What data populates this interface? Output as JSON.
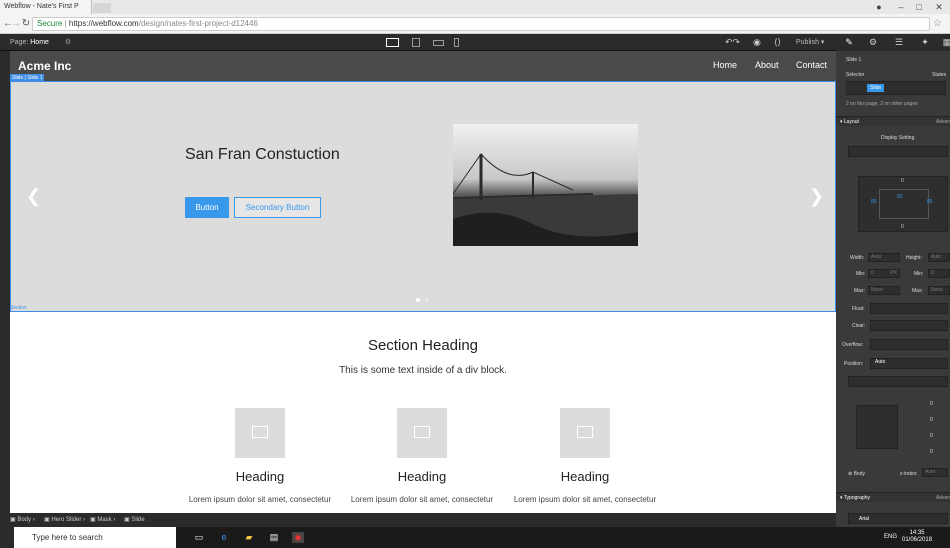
{
  "browser": {
    "tab_title": "Webflow - Nate's First P",
    "url_secure": "Secure",
    "url_host": "https://webflow.com",
    "url_path": "/design/nates-first-project-d12446"
  },
  "webflow_bar": {
    "page_label": "Page:",
    "page_name": "Home",
    "publish_label": "Publish"
  },
  "site": {
    "brand": "Acme Inc",
    "nav_links": [
      "Home",
      "About",
      "Contact"
    ],
    "slide_tag": "Slide | Slide 1",
    "hero_title": "San Fran Constuction",
    "button_primary": "Button",
    "button_secondary": "Secondary Button",
    "section_tag": "Section",
    "section_heading": "Section Heading",
    "section_text": "This is some text inside of a div block.",
    "cards": [
      {
        "heading": "Heading",
        "text": "Lorem ipsum dolor sit amet, consectetur adipiscing elit. Suspendisse varius enim in"
      },
      {
        "heading": "Heading",
        "text": "Lorem ipsum dolor sit amet, consectetur adipiscing elit. Suspendisse varius enim in"
      },
      {
        "heading": "Heading",
        "text": "Lorem ipsum dolor sit amet, consectetur adipiscing elit. Suspendisse varius enim in"
      }
    ]
  },
  "breadcrumbs": [
    "Body",
    "Hero Slider",
    "Mask",
    "Slide"
  ],
  "panel": {
    "element_name": "Slide 1",
    "selector_label": "Selector",
    "states_label": "States",
    "selector_chip": "Slide",
    "selector_note": "2 on this page, 2 on other pages",
    "layout_label": "Layout",
    "advanced_label": "Advan",
    "display_setting": "Display Setting",
    "width_label": "Width:",
    "height_label": "Height:",
    "auto_value": "Auto",
    "min_label": "Min:",
    "max_label": "Max:",
    "min_value": "0",
    "min_unit": "PX",
    "max_value": "None",
    "float_label": "Float:",
    "clear_label": "Clear:",
    "overflow_label": "Overflow:",
    "position_label": "Position:",
    "position_value": "Auto",
    "body_label": "Body",
    "zindex_label": "z-index:",
    "typography_label": "Typography",
    "font_value": "Arial",
    "spacing_zero": "0",
    "padding_val": "85",
    "padding_top": "92"
  },
  "taskbar": {
    "search_placeholder": "Type here to search",
    "lang": "ENG",
    "time": "14:35",
    "date": "01/06/2018"
  },
  "colors": {
    "accent": "#3898ec",
    "selection": "#3f8ee6",
    "navbar": "#4a4a4a",
    "hero_bg": "#dcdcdc"
  }
}
